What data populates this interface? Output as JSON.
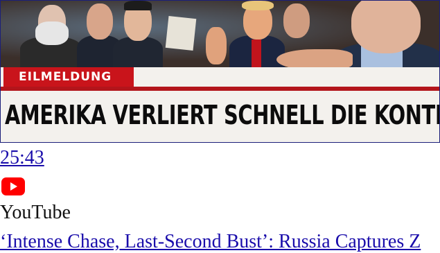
{
  "thumbnail": {
    "badge_text": "EILMELDUNG",
    "headline_text": "AMERIKA VERLIERT SCHNELL DIE KONTROLLE",
    "colors": {
      "badge": "#c9141b",
      "headline_bg": "#f3f1ed",
      "headline_text": "#0c0c0c"
    }
  },
  "video": {
    "duration": "25:43",
    "platform_icon": "youtube-play-icon",
    "source": "YouTube"
  },
  "next_result": {
    "title": "‘Intense Chase, Last-Second Bust’: Russia Captures Z"
  },
  "colors": {
    "link": "#1a0dab",
    "text": "#111111"
  }
}
